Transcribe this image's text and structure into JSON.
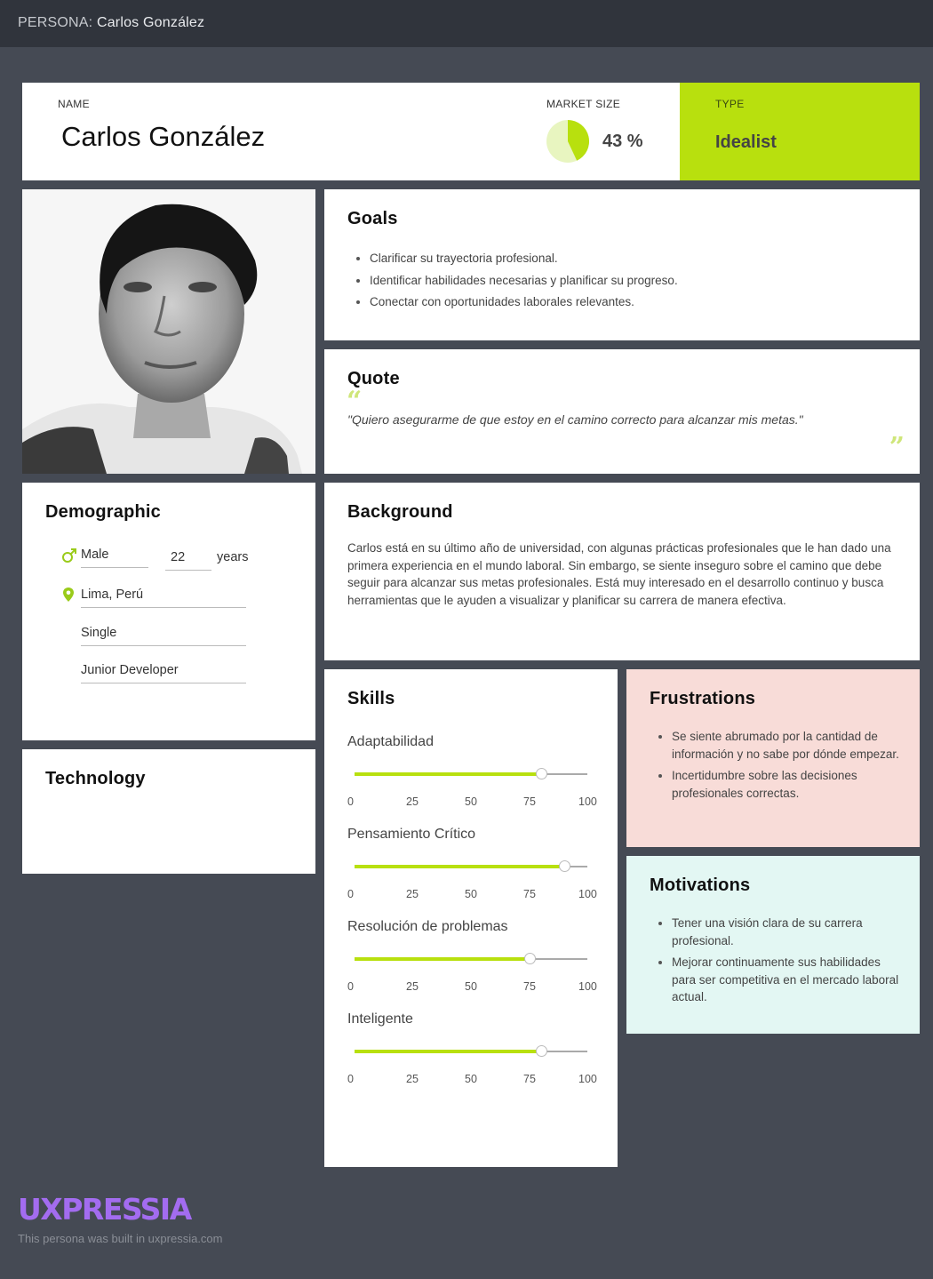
{
  "topbar": {
    "prefix": "PERSONA:",
    "name": "Carlos González"
  },
  "header": {
    "name_label": "NAME",
    "name": "Carlos González",
    "market_label": "MARKET SIZE",
    "market_value": "43 %",
    "market_fraction": 0.43,
    "type_label": "TYPE",
    "type_value": "Idealist",
    "accent": "#b8e00e"
  },
  "goals": {
    "title": "Goals",
    "items": [
      "Clarificar su trayectoria profesional.",
      "Identificar habilidades necesarias y planificar su progreso.",
      "Conectar con oportunidades laborales relevantes."
    ]
  },
  "quote": {
    "title": "Quote",
    "open_mark": "“",
    "text": "\"Quiero asegurarme de que estoy en el camino correcto para alcanzar mis metas.\"",
    "close_mark": "”"
  },
  "demographic": {
    "title": "Demographic",
    "gender": "Male",
    "age": "22",
    "age_unit": "years",
    "location": "Lima, Perú",
    "status": "Single",
    "occupation": "Junior Developer",
    "gender_icon": "male-icon",
    "location_icon": "map-pin-icon"
  },
  "technology": {
    "title": "Technology"
  },
  "background": {
    "title": "Background",
    "text": "Carlos está en su último año de universidad, con algunas prácticas profesionales que le han dado una primera experiencia en el mundo laboral. Sin embargo, se siente inseguro sobre el camino que debe seguir para alcanzar sus metas profesionales. Está muy interesado en el desarrollo continuo y busca herramientas que le ayuden a visualizar y planificar su carrera de manera efectiva."
  },
  "skills": {
    "title": "Skills",
    "ticks": [
      "0",
      "25",
      "50",
      "75",
      "100"
    ],
    "items": [
      {
        "name": "Adaptabilidad",
        "value": 80
      },
      {
        "name": "Pensamiento Crítico",
        "value": 90
      },
      {
        "name": "Resolución de problemas",
        "value": 75
      },
      {
        "name": "Inteligente",
        "value": 80
      }
    ]
  },
  "frustrations": {
    "title": "Frustrations",
    "items": [
      "Se siente abrumado por la cantidad de información y no sabe por dónde empezar.",
      "Incertidumbre sobre las decisiones profesionales correctas."
    ],
    "color": "#f8dcd8"
  },
  "motivations": {
    "title": "Motivations",
    "items": [
      "Tener una visión clara de su carrera profesional.",
      "Mejorar continuamente sus habilidades para ser competitiva en el mercado laboral actual."
    ],
    "color": "#e3f7f3"
  },
  "footer": {
    "logo": "UXPRESSIA",
    "text": "This persona was built in uxpressia.com"
  }
}
